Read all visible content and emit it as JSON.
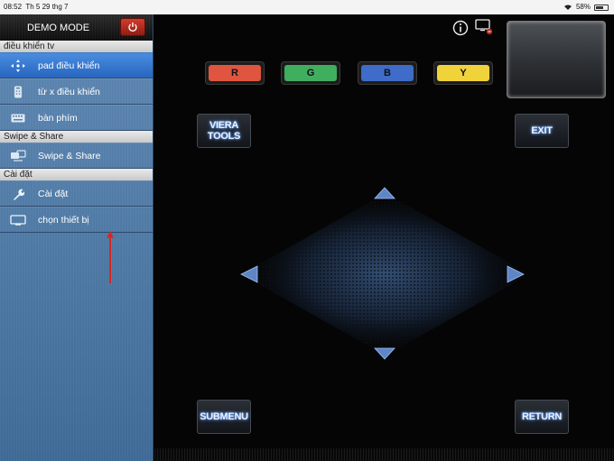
{
  "status_bar": {
    "time": "08:52",
    "date": "Th 5 29 thg 7",
    "battery": "58%",
    "battery_level": 0.58
  },
  "sidebar": {
    "header": {
      "title": "DEMO MODE",
      "power_icon": "power-icon",
      "power_color": "#c0281c"
    },
    "sections": [
      {
        "title": "điều khiển tv",
        "items": [
          {
            "label": "pad điều khiển",
            "icon": "dpad-icon",
            "active": true
          },
          {
            "label": "từ x điều khiển",
            "icon": "remote-icon",
            "active": false
          },
          {
            "label": "bàn phím",
            "icon": "keyboard-icon",
            "active": false
          }
        ]
      },
      {
        "title": "Swipe & Share",
        "items": [
          {
            "label": "Swipe & Share",
            "icon": "swipe-share-icon",
            "active": false
          }
        ]
      },
      {
        "title": "Cài đặt",
        "items": [
          {
            "label": "Cài đặt",
            "icon": "wrench-icon",
            "active": false
          },
          {
            "label": "chọn thiết bị",
            "icon": "tv-monitor-icon",
            "active": false
          }
        ]
      }
    ]
  },
  "main": {
    "top_icons": [
      "info-icon",
      "screen-mirror-icon"
    ],
    "color_buttons": [
      {
        "label": "R",
        "color": "#e0553f"
      },
      {
        "label": "G",
        "color": "#3fae5e"
      },
      {
        "label": "B",
        "color": "#3f6bc9"
      },
      {
        "label": "Y",
        "color": "#f0d23a"
      }
    ],
    "buttons": {
      "viera_tools": "VIERA TOOLS",
      "exit": "EXIT",
      "submenu": "SUBMENU",
      "return": "RETURN"
    },
    "accent_color": "#4f8fff"
  }
}
